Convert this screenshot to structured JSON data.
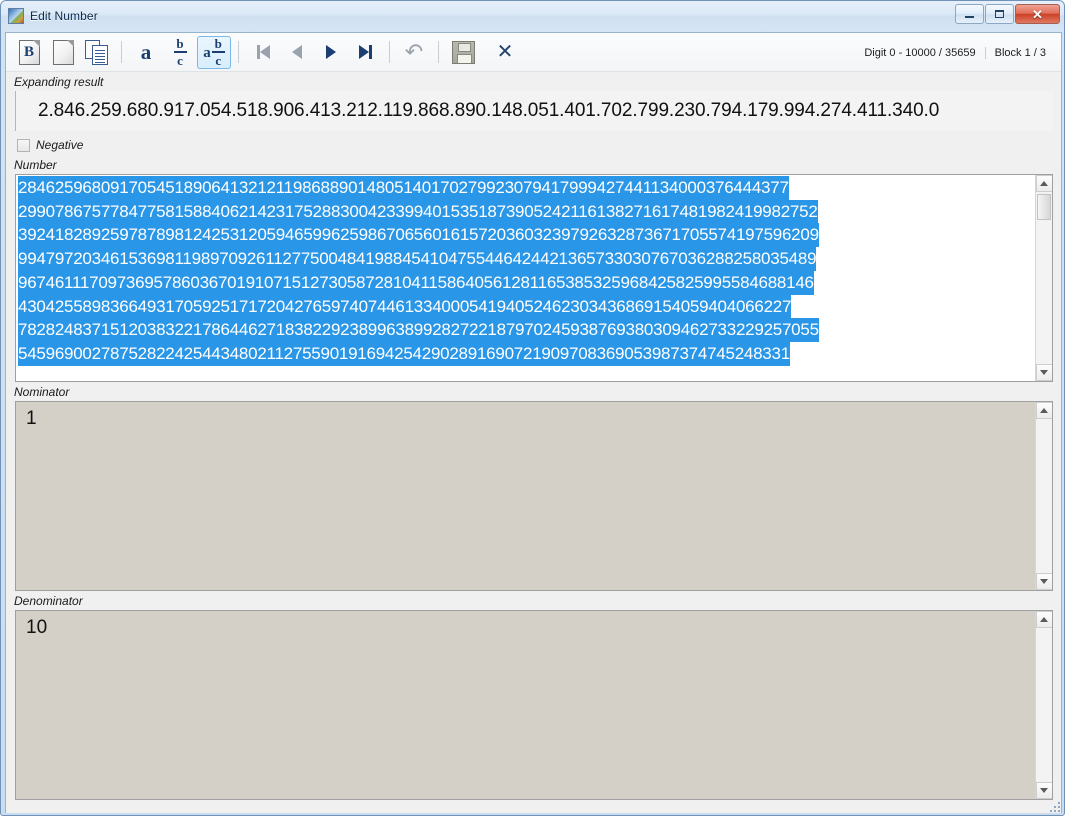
{
  "window": {
    "title": "Edit Number",
    "app_icon": "app-icon",
    "minimize_label": "–",
    "maximize_label": "□",
    "close_label": "✕"
  },
  "toolbar": {
    "buttons": [
      {
        "name": "bold-document-button",
        "icon": "document-bold-icon",
        "letter": "B",
        "selected": false
      },
      {
        "name": "new-document-button",
        "icon": "blank-document-icon",
        "letter": "",
        "selected": false
      },
      {
        "name": "copy-button",
        "icon": "copy-documents-icon",
        "letter": "",
        "selected": false
      },
      {
        "name": "plain-number-button",
        "icon": "letter-a-icon",
        "letter": "a",
        "selected": false
      },
      {
        "name": "fraction-button",
        "icon": "fraction-bc-icon",
        "numerator": "b",
        "denominator": "c",
        "selected": false
      },
      {
        "name": "mixed-fraction-button",
        "icon": "mixed-fraction-abc-icon",
        "lead": "a",
        "numerator": "b",
        "denominator": "c",
        "selected": true
      }
    ],
    "nav": [
      {
        "name": "first-block-button",
        "icon": "skip-to-start-icon",
        "enabled": false
      },
      {
        "name": "previous-block-button",
        "icon": "step-back-icon",
        "enabled": false
      },
      {
        "name": "next-block-button",
        "icon": "step-forward-icon",
        "enabled": true
      },
      {
        "name": "last-block-button",
        "icon": "skip-to-end-icon",
        "enabled": true
      }
    ],
    "undo": {
      "name": "undo-button",
      "icon": "undo-arrow-icon",
      "glyph": "↶",
      "enabled": false
    },
    "save": {
      "name": "save-button",
      "icon": "floppy-disk-icon",
      "enabled": true
    },
    "close": {
      "name": "close-editor-button",
      "icon": "close-x-icon",
      "glyph": "✕",
      "enabled": true
    },
    "status": {
      "digit_range": "Digit 0 - 10000 / 35659",
      "block": "Block 1 / 3"
    }
  },
  "expanding_result": {
    "label": "Expanding result",
    "value": "2.846.259.680.917.054.518.906.413.212.119.868.890.148.051.401.702.799.230.794.179.994.274.411.340.0"
  },
  "negative": {
    "label": "Negative",
    "checked": false
  },
  "number": {
    "label": "Number",
    "lines": [
      "284625968091705451890641321211986889014805140170279923079417999427441134000376444377",
      "299078675778477581588406214231752883004233994015351873905242116138271617481982419982752",
      "392418289259787898124253120594659962598670656016157203603239792632873671705574197596209",
      "994797203461536981198970926112775004841988454104755446424421365733030767036288258035489",
      "967461117097369578603670191071512730587281041158640561281165385325968425825995584688146",
      "430425589836649317059251717204276597407446133400054194052462303436869154059404066227",
      "782824837151203832217864462718382292389963899282722187970245938769380309462733229257055",
      "545969002787528224254434802112755901916942542902891690721909708369053987374745248331"
    ]
  },
  "nominator": {
    "label": "Nominator",
    "value": "1"
  },
  "denominator": {
    "label": "Denominator",
    "value": "10"
  }
}
